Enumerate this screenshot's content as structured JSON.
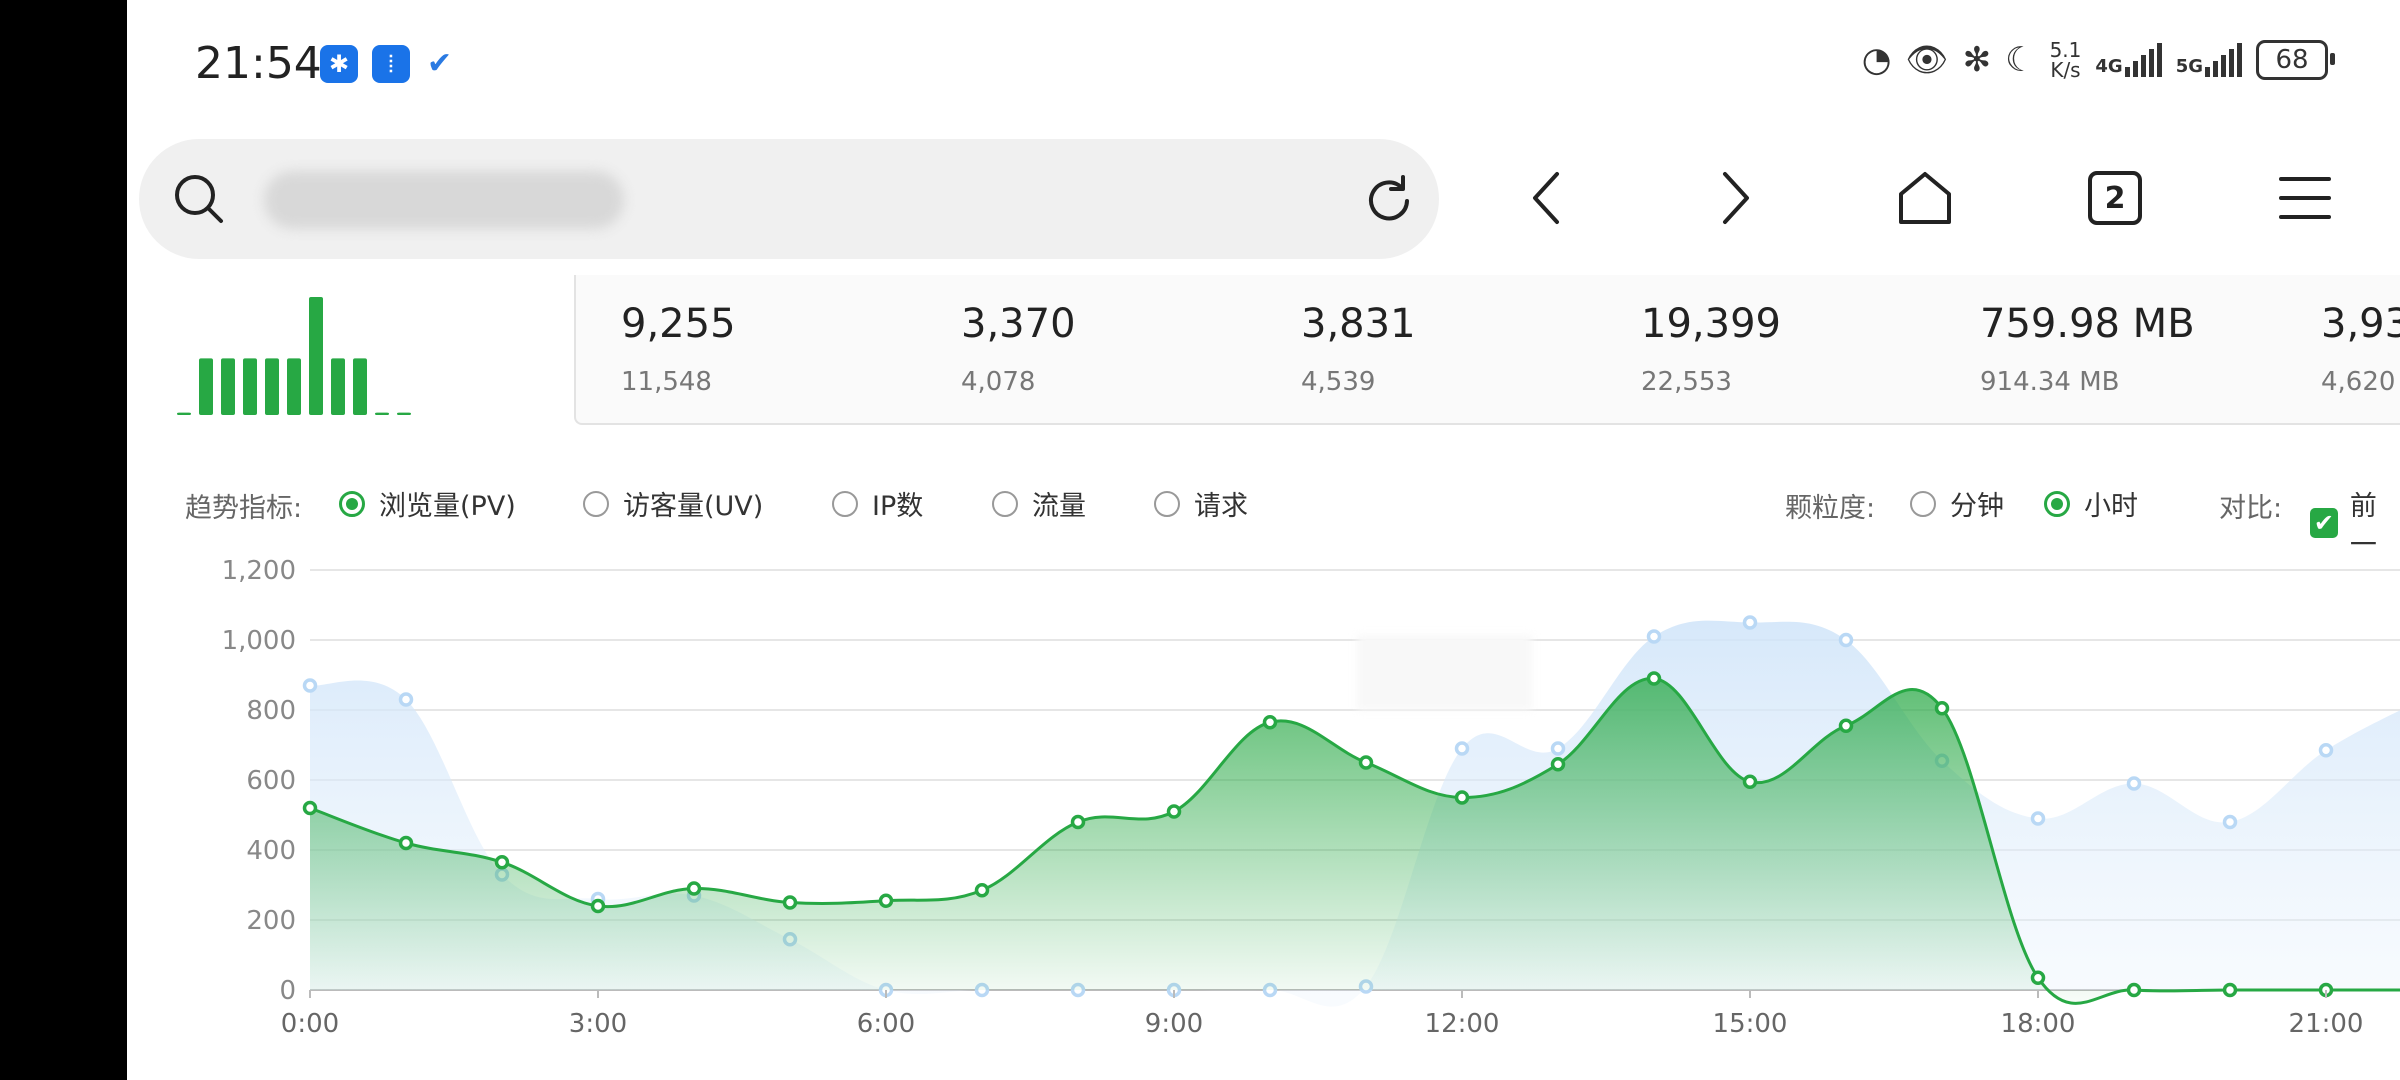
{
  "status_bar": {
    "time": "21:54",
    "net_speed_top": "5.1",
    "net_speed_bottom": "K/s",
    "net1": "4G",
    "net2": "5G",
    "battery": "68"
  },
  "toolbar": {
    "url": "",
    "tab_count": "2"
  },
  "mini_bars": [
    0.02,
    0.48,
    0.48,
    0.48,
    0.48,
    0.48,
    1.0,
    0.48,
    0.48,
    0.02,
    0.02
  ],
  "stats": [
    {
      "value": "9,255",
      "prev": "11,548"
    },
    {
      "value": "3,370",
      "prev": "4,078"
    },
    {
      "value": "3,831",
      "prev": "4,539"
    },
    {
      "value": "19,399",
      "prev": "22,553"
    },
    {
      "value": "759.98 MB",
      "prev": "914.34 MB"
    },
    {
      "value": "3,93",
      "prev": "4,620"
    }
  ],
  "filters": {
    "trend_label": "趋势指标:",
    "metrics": [
      {
        "label": "浏览量(PV)",
        "selected": true
      },
      {
        "label": "访客量(UV)",
        "selected": false
      },
      {
        "label": "IP数",
        "selected": false
      },
      {
        "label": "流量",
        "selected": false
      },
      {
        "label": "请求",
        "selected": false
      }
    ],
    "granularity_label": "颗粒度:",
    "granularity": [
      {
        "label": "分钟",
        "selected": false
      },
      {
        "label": "小时",
        "selected": true
      }
    ],
    "compare_label": "对比:",
    "compare_option": "前一",
    "compare_checked": true
  },
  "colors": {
    "accent": "#27a844",
    "compare_series": "#b9d8f5"
  },
  "chart_data": {
    "type": "area",
    "x": [
      "0:00",
      "1:00",
      "2:00",
      "3:00",
      "4:00",
      "5:00",
      "6:00",
      "7:00",
      "8:00",
      "9:00",
      "10:00",
      "11:00",
      "12:00",
      "13:00",
      "14:00",
      "15:00",
      "16:00",
      "17:00",
      "18:00",
      "19:00",
      "20:00",
      "21:00",
      "22:00"
    ],
    "x_tick_labels": [
      "0:00",
      "3:00",
      "6:00",
      "9:00",
      "12:00",
      "15:00",
      "18:00",
      "21:00"
    ],
    "y_tick_labels": [
      "0",
      "200",
      "400",
      "600",
      "800",
      "1,000",
      "1,200"
    ],
    "ylim": [
      0,
      1200
    ],
    "grid": true,
    "series": [
      {
        "values": [
          520,
          420,
          365,
          240,
          290,
          250,
          255,
          285,
          480,
          510,
          765,
          650,
          550,
          645,
          890,
          595,
          755,
          805,
          35,
          0,
          0,
          0,
          0
        ]
      },
      {
        "values": [
          870,
          830,
          330,
          260,
          270,
          145,
          0,
          0,
          0,
          0,
          0,
          10,
          690,
          690,
          1010,
          1050,
          1000,
          655,
          490,
          590,
          480,
          685,
          830
        ]
      }
    ]
  }
}
